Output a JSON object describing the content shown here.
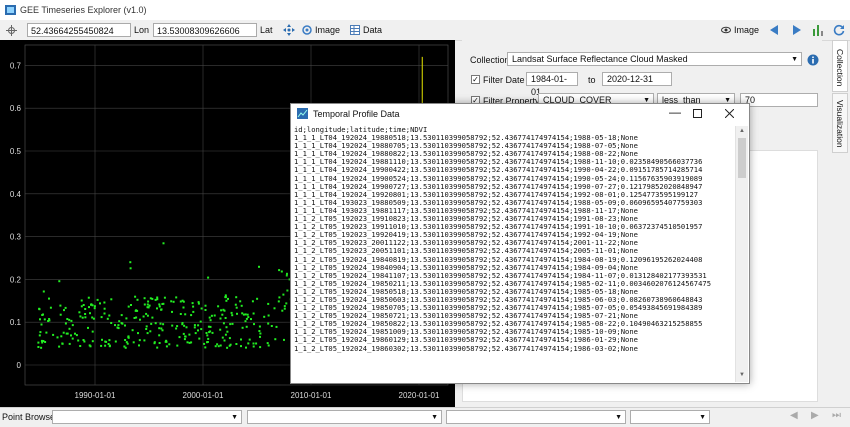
{
  "window": {
    "title": "GEE Timeseries Explorer (v1.0)"
  },
  "toolbar": {
    "lat_value": "52.43664255450824",
    "lon_label": "Lon",
    "lon_value": "13.53008309626606",
    "lat_label": "Lat",
    "image_label": "Image",
    "data_label": "Data",
    "image_right_label": "Image"
  },
  "plot": {
    "y_ticks": [
      "0.7",
      "0.6",
      "0.5",
      "0.4",
      "0.3",
      "0.2",
      "0.1",
      "0"
    ],
    "x_ticks": [
      "1990-01-01",
      "2000-01-01",
      "2010-01-01",
      "2020-01-01"
    ],
    "point_color": "#22ee22"
  },
  "panel": {
    "collection_label": "Collection",
    "collection_value": "Landsat Surface Reflectance Cloud Masked",
    "filter_date_label": "Filter Date",
    "date_from": "1984-01-01",
    "to_label": "to",
    "date_to": "2020-12-31",
    "filter_property_label": "Filter Property",
    "property_value": "CLOUD_COVER",
    "operator_value": "less_than",
    "threshold_value": "70",
    "tab_collection": "Collection",
    "tab_visualization": "Visualization"
  },
  "dialog": {
    "title": "Temporal Profile Data",
    "lines": [
      "id;longitude;latitude;time;NDVI",
      "1_1_1_LT04_192024_19880518;13.530110399058792;52.43677417497415​4;1988-05-18;None",
      "1_1_1_LT04_192024_19880705;13.530110399058792;52.436774174974154;1988-07-05;None",
      "1_1_1_LT04_192024_19880822;13.530110399058792;52.436774174974154;1988-08-22;None",
      "1_1_1_LT04_192024_19881110;13.530110399058792;52.436774174974154;1988-11-10;0.02358490566037736",
      "1_1_1_LT04_192024_19900422;13.530110399058792;52.436774174974154;1990-04-22;0.09151785714285714",
      "1_1_1_LT04_192024_19900524;13.530110399058792;52.436774174974154;1990-05-24;0.11567635903919089",
      "1_1_1_LT04_192024_19900727;13.530110399058792;52.436774174974154;1990-07-27;0.12179852020848947",
      "1_1_1_LT04_192024_19920801;13.530110399058792;52.436774174974154;1992-08-01;0.1254773595199127",
      "1_1_1_LT04_193023_19880509;13.530110399058792;52.436774174974154;1988-05-09;0.06096595407759303",
      "1_1_1_LT04_193023_19881117;13.530110399058792;52.436774174974154;1988-11-17;None",
      "1_1_2_LT05_192023_19910823;13.530110399058792;52.436774174974154;1991-08-23;None",
      "1_1_2_LT05_192023_19911010;13.530110399058792;52.436774174974154;1991-10-10;0.06372374510501957",
      "1_1_2_LT05_192023_19920419;13.530110399058792;52.436774174974154;1992-04-19;None",
      "1_1_2_LT05_192023_20011122;13.530110399058792;52.436774174974154;2001-11-22;None",
      "1_1_2_LT05_192023_20051101;13.530110399058792;52.436774174974154;2005-11-01;None",
      "1_1_2_LT05_192024_19840819;13.530110399058792;52.436774174974154;1984-08-19;0.12096195262024408",
      "1_1_2_LT05_192024_19840904;13.530110399058792;52.436774174974154;1984-09-04;None",
      "1_1_2_LT05_192024_19841107;13.530110399058792;52.436774174974154;1984-11-07;0.013128402177393531",
      "1_1_2_LT05_192024_19850211;13.530110399058792;52.436774174974154;1985-02-11;0.0034602076124567475",
      "1_1_2_LT05_192024_19850518;13.530110399058792;52.436774174974154;1985-05-18;None",
      "1_1_2_LT05_192024_19850603;13.530110399058792;52.436774174974154;1985-06-03;0.08260738960648843",
      "1_1_2_LT05_192024_19850705;13.530110399058792;52.436774174974154;1985-07-05;0.05493845691984389",
      "1_1_2_LT05_192024_19850721;13.530110399058792;52.436774174974154;1985-07-21;None",
      "1_1_2_LT05_192024_19850822;13.530110399058792;52.436774174974154;1985-08-22;0.10490463215258855",
      "1_1_2_LT05_192024_19851009;13.530110399058792;52.436774174974154;1985-10-09;None",
      "1_1_2_LT05_192024_19860129;13.530110399058792;52.436774174974154;1986-01-29;None",
      "1_1_2_LT05_192024_19860302;13.530110399058792;52.436774174974154;1986-03-02;None"
    ]
  },
  "statusbar": {
    "point_browser_label": "Point Browser"
  }
}
